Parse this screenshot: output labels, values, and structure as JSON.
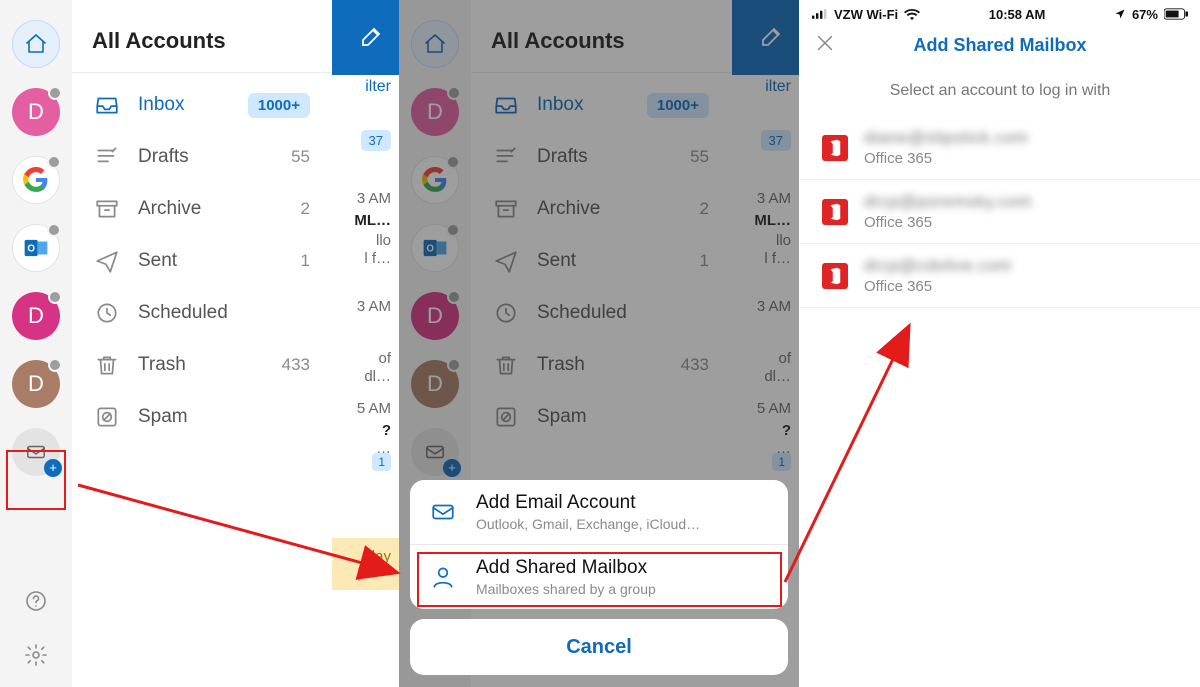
{
  "header": {
    "title": "All Accounts"
  },
  "folders": [
    {
      "key": "inbox",
      "label": "Inbox",
      "count": "1000+",
      "active": true
    },
    {
      "key": "drafts",
      "label": "Drafts",
      "count": "55",
      "active": false
    },
    {
      "key": "archive",
      "label": "Archive",
      "count": "2",
      "active": false
    },
    {
      "key": "sent",
      "label": "Sent",
      "count": "1",
      "active": false
    },
    {
      "key": "scheduled",
      "label": "Scheduled",
      "count": "",
      "active": false
    },
    {
      "key": "trash",
      "label": "Trash",
      "count": "433",
      "active": false
    },
    {
      "key": "spam",
      "label": "Spam",
      "count": "",
      "active": false
    }
  ],
  "accounts_strip": [
    {
      "kind": "home"
    },
    {
      "kind": "pink",
      "letter": "D",
      "dot": true
    },
    {
      "kind": "google",
      "dot": true
    },
    {
      "kind": "outlook",
      "dot": true
    },
    {
      "kind": "magenta",
      "letter": "D",
      "dot": true
    },
    {
      "kind": "brown",
      "letter": "D",
      "dot": true
    },
    {
      "kind": "add"
    }
  ],
  "peek": {
    "filter": "ilter",
    "chip": "37",
    "rows": [
      {
        "t1": "3 AM",
        "t2": "ML…",
        "t3": "llo",
        "t4": "l  f…"
      },
      {
        "t1": "3 AM",
        "t5": "of",
        "t6": "dl…"
      },
      {
        "t1": "5 AM",
        "t7": "?",
        "t8": "…"
      }
    ],
    "inboxnum": "1",
    "yellow": "rday"
  },
  "actionsheet": {
    "rows": [
      {
        "title": "Add Email Account",
        "sub": "Outlook, Gmail, Exchange, iCloud…",
        "icon": "mail"
      },
      {
        "title": "Add Shared Mailbox",
        "sub": "Mailboxes shared by a group",
        "icon": "person"
      }
    ],
    "cancel": "Cancel"
  },
  "screen3": {
    "status": {
      "carrier": "VZW Wi-Fi",
      "time": "10:58 AM",
      "battery": "67%"
    },
    "title": "Add Shared Mailbox",
    "hint": "Select an account to log in with",
    "accounts": [
      {
        "email": "diane@slipstick.com",
        "provider": "Office 365"
      },
      {
        "email": "drcp@poremsky.com",
        "provider": "Office 365"
      },
      {
        "email": "drcp@cdolive.com",
        "provider": "Office 365"
      }
    ]
  }
}
